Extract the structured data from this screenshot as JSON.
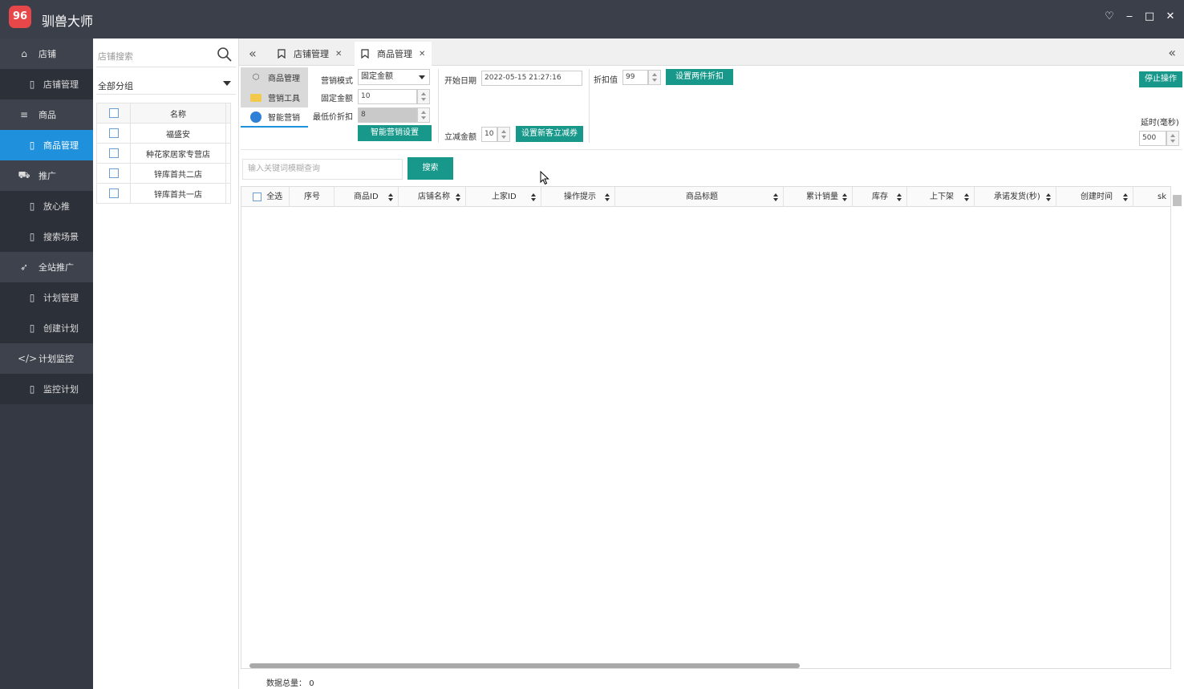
{
  "app": {
    "title": "驯兽大师",
    "logo_text": "96"
  },
  "window_controls": {
    "skin": "♡",
    "minimize": "‒",
    "maximize": "□",
    "close": "✕"
  },
  "nav": [
    {
      "type": "group",
      "label": "店铺",
      "icon": "home-icon"
    },
    {
      "type": "sub",
      "label": "店铺管理",
      "icon": "bookmark-icon"
    },
    {
      "type": "group",
      "label": "商品",
      "icon": "list-icon"
    },
    {
      "type": "sub",
      "label": "商品管理",
      "icon": "bookmark-icon",
      "active": true
    },
    {
      "type": "group",
      "label": "推广",
      "icon": "car-icon"
    },
    {
      "type": "sub",
      "label": "放心推",
      "icon": "bookmark-icon"
    },
    {
      "type": "sub",
      "label": "搜索场景",
      "icon": "bookmark-icon"
    },
    {
      "type": "group",
      "label": "全站推广",
      "icon": "rocket-icon"
    },
    {
      "type": "sub",
      "label": "计划管理",
      "icon": "bookmark-icon"
    },
    {
      "type": "sub",
      "label": "创建计划",
      "icon": "bookmark-icon"
    },
    {
      "type": "group",
      "label": "计划监控",
      "icon": "code-icon"
    },
    {
      "type": "sub",
      "label": "监控计划",
      "icon": "bookmark-icon"
    }
  ],
  "store_panel": {
    "search_placeholder": "店铺搜索",
    "group_select": "全部分组",
    "column_name": "名称",
    "stores": [
      "福盛安",
      "种花家居家专营店",
      "锌库首共二店",
      "锌库首共一店"
    ]
  },
  "tabs": [
    {
      "label": "店铺管理"
    },
    {
      "label": "商品管理",
      "active": true
    }
  ],
  "side_menu": [
    "商品管理",
    "营销工具",
    "智能营销"
  ],
  "form": {
    "mode_label": "营销模式",
    "mode_value": "固定金额",
    "fixed_amount_label": "固定金额",
    "fixed_amount_value": "10",
    "min_discount_label": "最低价折扣",
    "min_discount_value": "8",
    "smart_btn": "智能营销设置",
    "start_date_label": "开始日期",
    "start_date_value": "2022-05-15 21:27:16",
    "instant_label": "立减金额",
    "instant_value": "10",
    "instant_btn": "设置新客立减券",
    "discount_label": "折扣值",
    "discount_value": "99",
    "discount_btn": "设置两件折扣",
    "stop_btn": "停止操作",
    "delay_label": "延时(毫秒)",
    "delay_value": "500"
  },
  "search": {
    "placeholder": "输入关键词模糊查询",
    "button": "搜索"
  },
  "grid": {
    "select_all": "全选",
    "columns": [
      "序号",
      "商品ID",
      "店铺名称",
      "上家ID",
      "操作提示",
      "商品标题",
      "累计销量",
      "库存",
      "上下架",
      "承诺发货(秒)",
      "创建时间",
      "sk"
    ]
  },
  "footer": {
    "total_label": "数据总量：",
    "total_value": "0"
  },
  "colors": {
    "accent": "#17988a",
    "nav_active": "#1e90dc",
    "titlebar": "#3b3f4a",
    "nav_bg": "#353944"
  }
}
